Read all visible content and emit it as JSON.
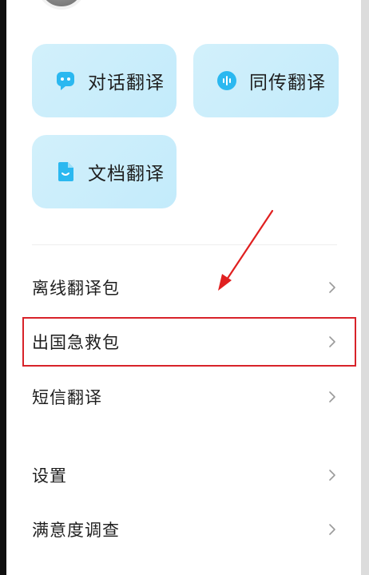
{
  "quick_actions": [
    {
      "label": "对话翻译",
      "icon": "chat-bubble-icon"
    },
    {
      "label": "同传翻译",
      "icon": "audio-wave-icon"
    },
    {
      "label": "文档翻译",
      "icon": "document-icon"
    }
  ],
  "menu": {
    "items": [
      {
        "label": "离线翻译包"
      },
      {
        "label": "出国急救包"
      },
      {
        "label": "短信翻译"
      },
      {
        "label": "设置"
      },
      {
        "label": "满意度调查"
      }
    ]
  },
  "colors": {
    "card_bg": "#c9edfb",
    "icon_blue": "#2bb8f0",
    "highlight": "#d8232a",
    "arrow": "#e02020"
  },
  "annotation": {
    "highlighted_item": "出国急救包"
  }
}
